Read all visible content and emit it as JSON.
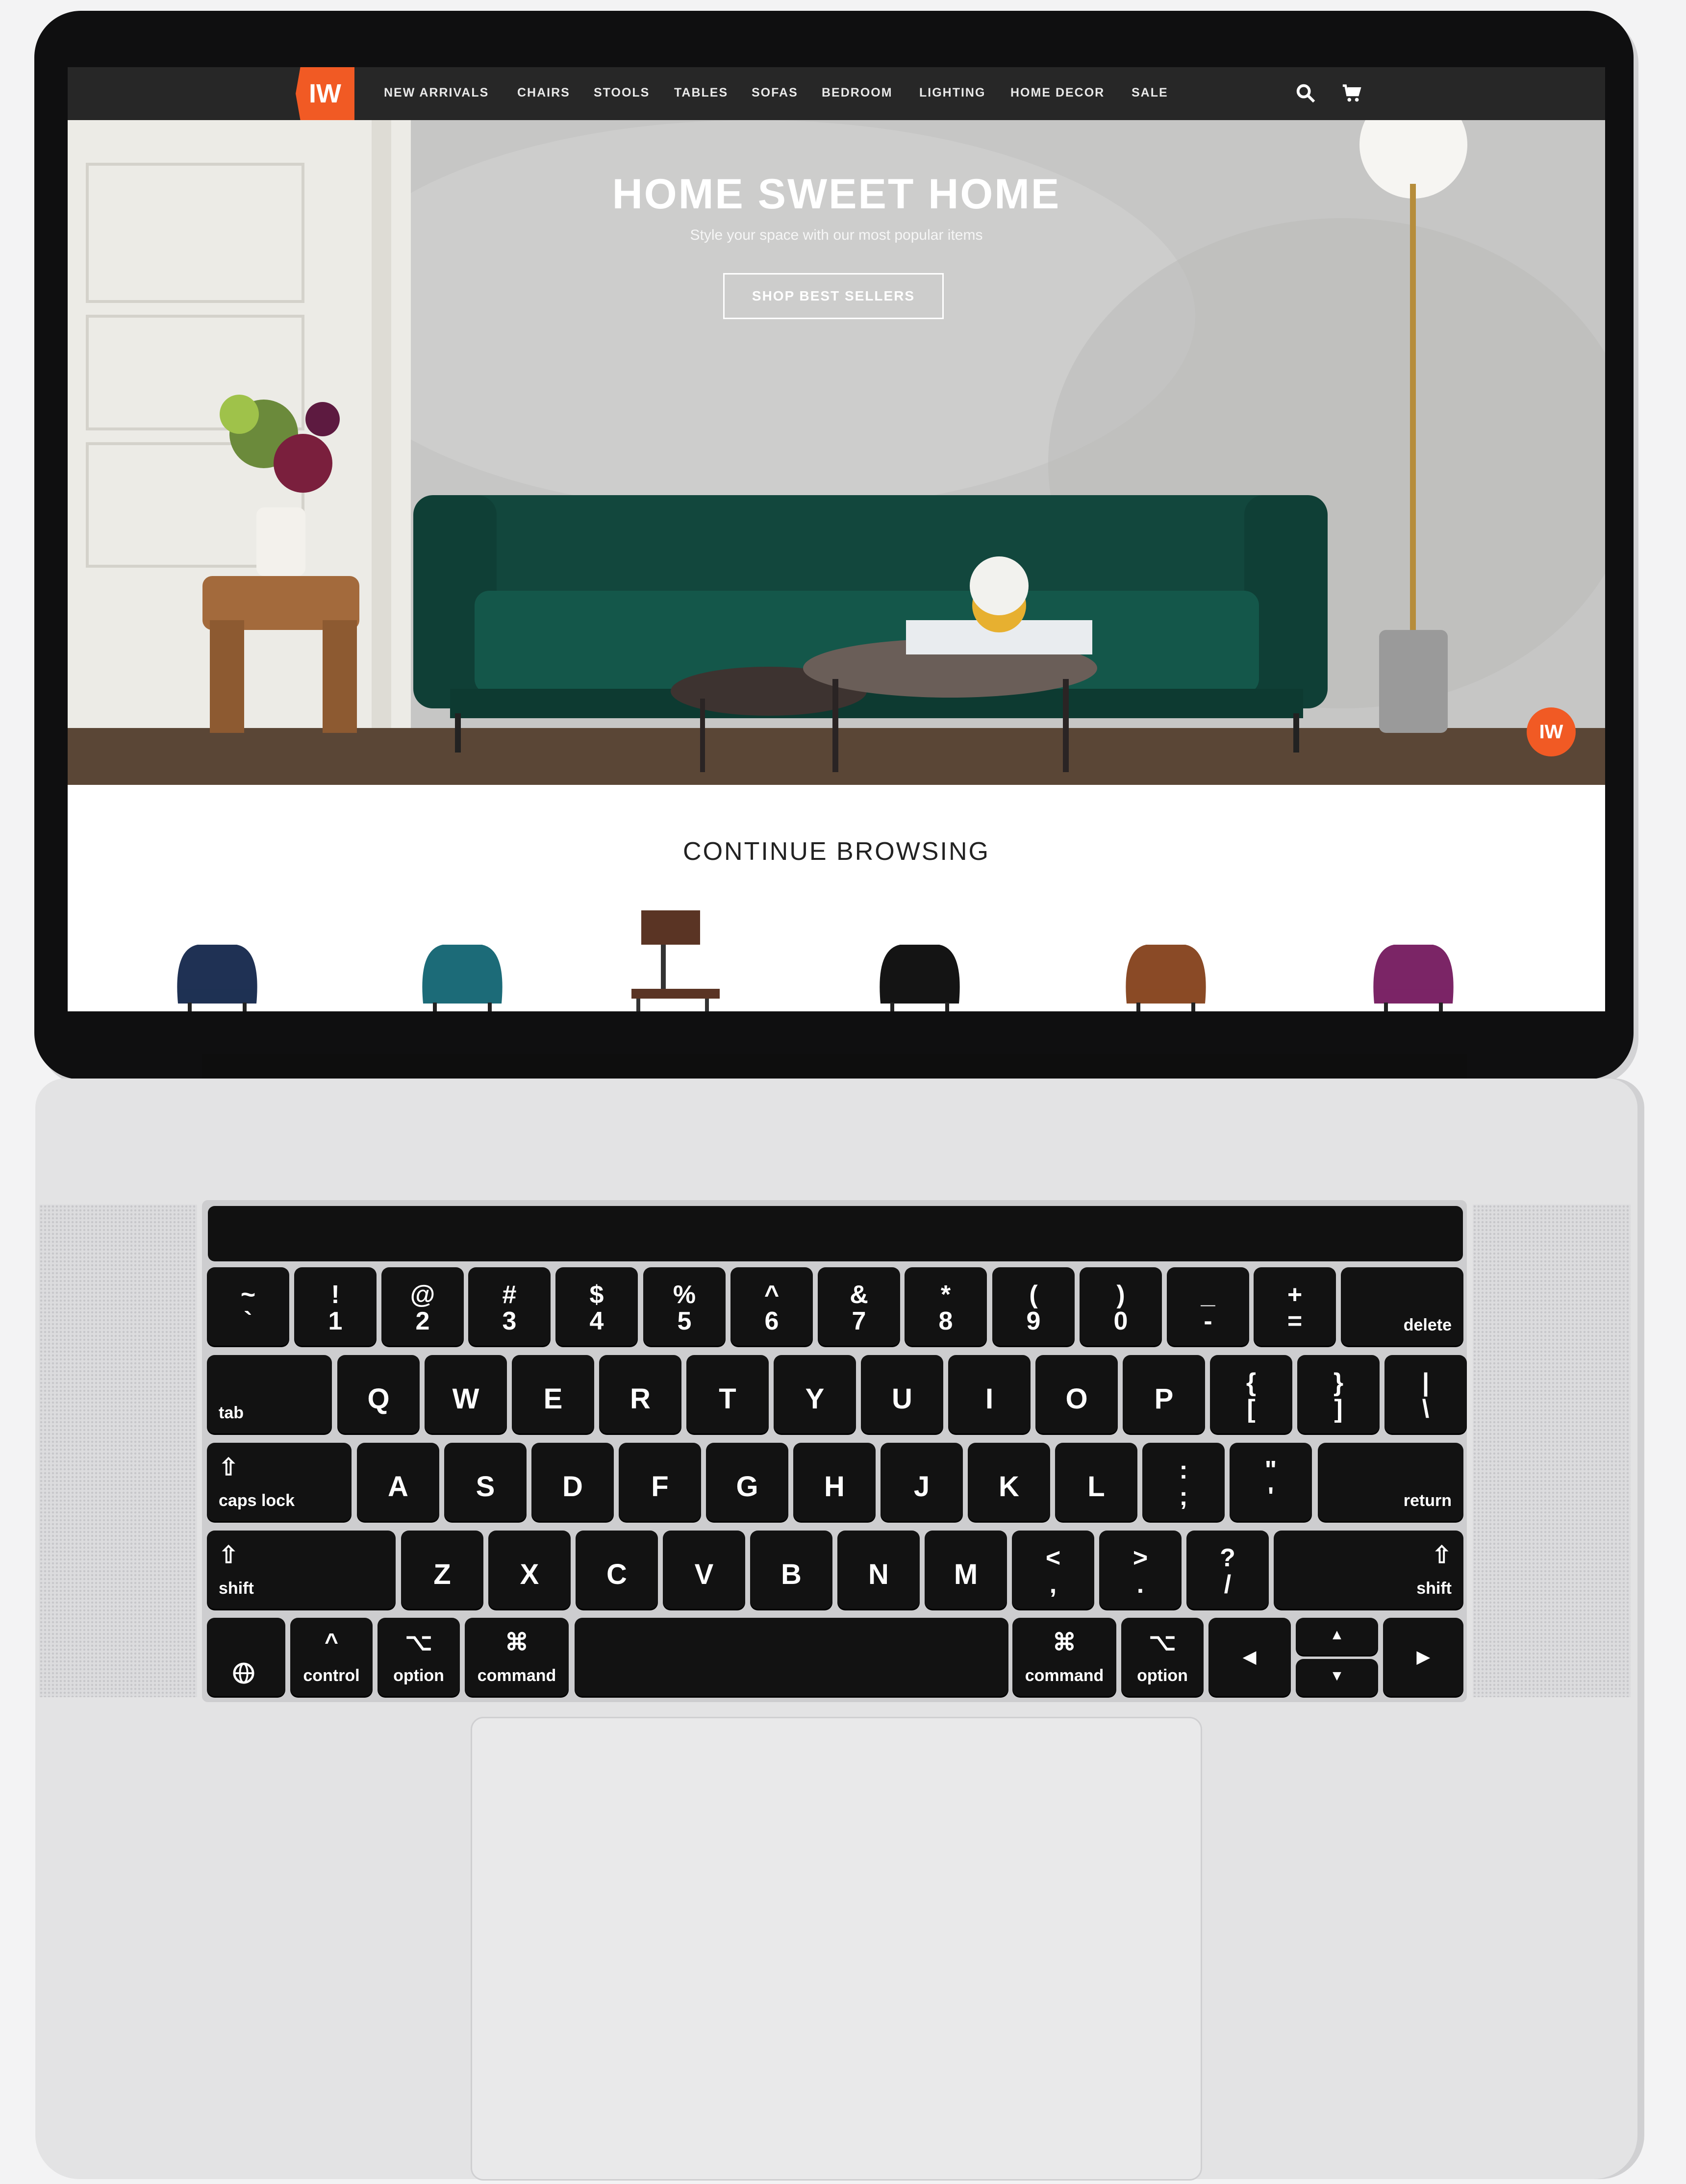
{
  "site": {
    "logo": "IW",
    "nav": [
      "NEW ARRIVALS",
      "CHAIRS",
      "STOOLS",
      "TABLES",
      "SOFAS",
      "BEDROOM",
      "LIGHTING",
      "HOME DECOR",
      "SALE"
    ],
    "icons": [
      "search-icon",
      "cart-icon"
    ],
    "accent": "#f15a24"
  },
  "hero": {
    "title": "HOME SWEET HOME",
    "subtitle": "Style your space with our most popular items",
    "button": "SHOP BEST SELLERS",
    "chat_badge": "IW"
  },
  "browse": {
    "title": "CONTINUE BROWSING",
    "products": [
      {
        "color": "#1f3154"
      },
      {
        "color": "#1c6b78"
      },
      {
        "color": "#5a3424"
      },
      {
        "color": "#141414"
      },
      {
        "color": "#8a4a26"
      },
      {
        "color": "#7b2566"
      }
    ]
  },
  "keyboard": {
    "row1": [
      [
        "~",
        "`"
      ],
      [
        "!",
        "1"
      ],
      [
        "@",
        "2"
      ],
      [
        "#",
        "3"
      ],
      [
        "$",
        "4"
      ],
      [
        "%",
        "5"
      ],
      [
        "^",
        "6"
      ],
      [
        "&",
        "7"
      ],
      [
        "*",
        "8"
      ],
      [
        "(",
        "9"
      ],
      [
        ")",
        "0"
      ],
      [
        "_",
        "-"
      ],
      [
        "+",
        "="
      ]
    ],
    "delete": "delete",
    "tab": "tab",
    "row2": [
      "Q",
      "W",
      "E",
      "R",
      "T",
      "Y",
      "U",
      "I",
      "O",
      "P"
    ],
    "row2_sym": [
      [
        "{",
        "["
      ],
      [
        "}",
        "]"
      ],
      [
        "|",
        "\\"
      ]
    ],
    "caps": "caps lock",
    "row3": [
      "A",
      "S",
      "D",
      "F",
      "G",
      "H",
      "J",
      "K",
      "L"
    ],
    "row3_sym": [
      [
        ":",
        ";"
      ],
      [
        "\"",
        "'"
      ]
    ],
    "return": "return",
    "shift": "shift",
    "row4": [
      "Z",
      "X",
      "C",
      "V",
      "B",
      "N",
      "M"
    ],
    "row4_sym": [
      [
        "<",
        ","
      ],
      [
        ">",
        "."
      ],
      [
        "?",
        "/"
      ]
    ],
    "control": "control",
    "option": "option",
    "command": "command",
    "control_sym": "^",
    "option_sym": "⌥",
    "command_sym": "⌘",
    "shift_sym": "⇧",
    "arrows": {
      "left": "◀",
      "right": "▶",
      "up": "▲",
      "down": "▼"
    }
  }
}
